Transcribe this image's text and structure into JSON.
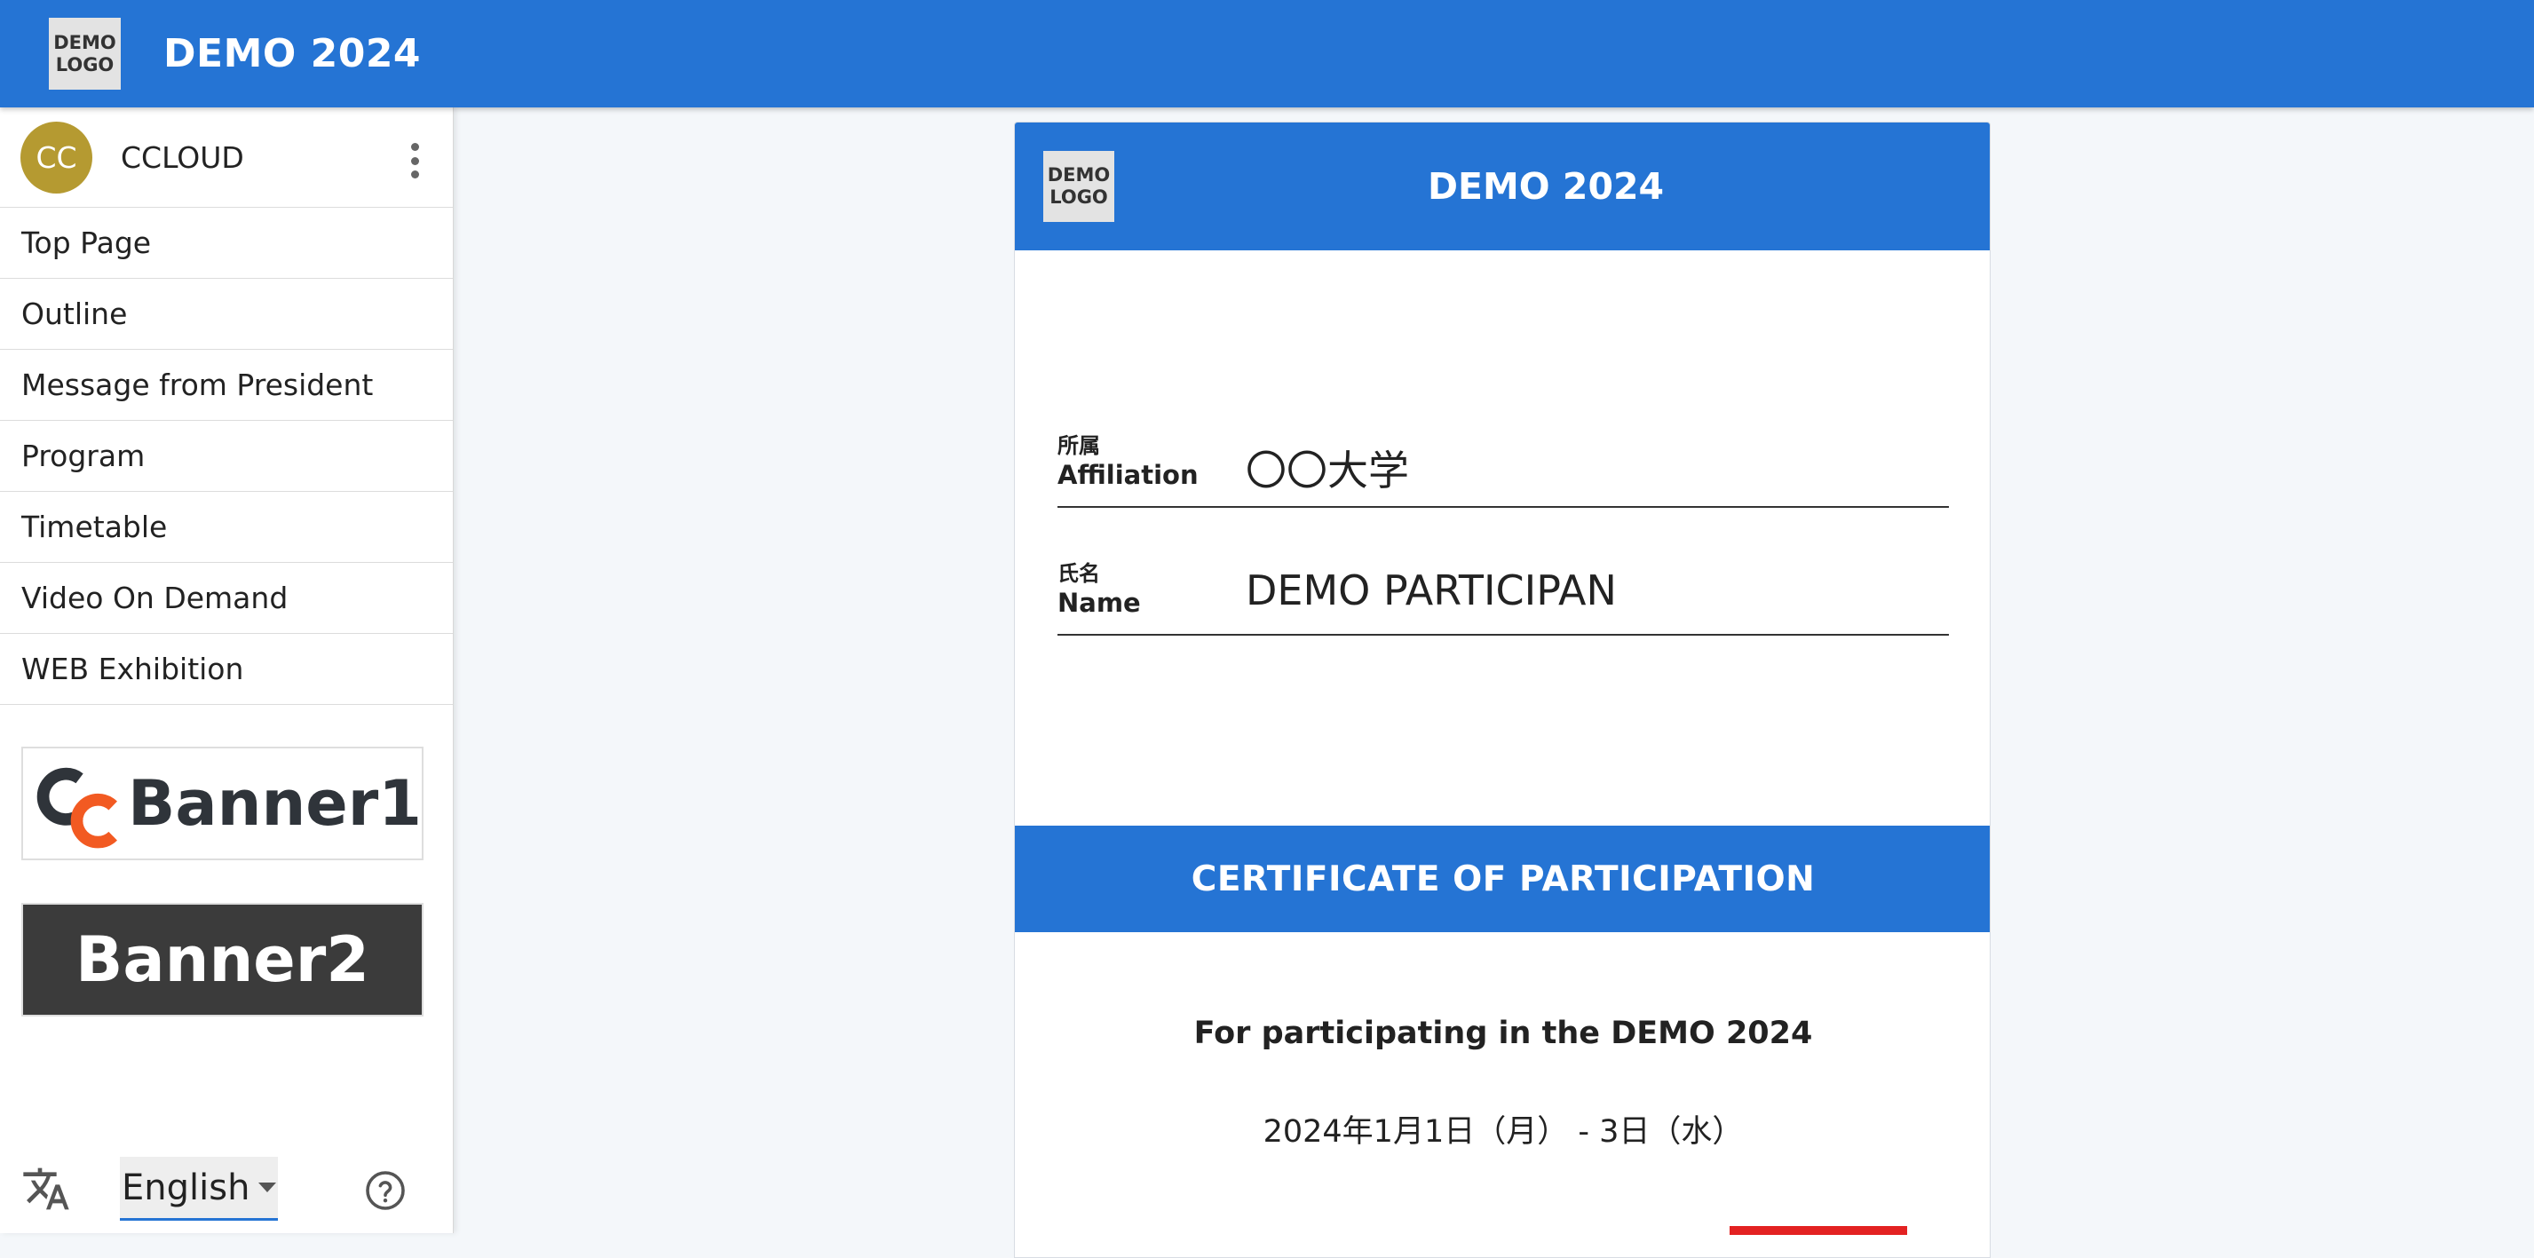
{
  "appbar": {
    "logo_line1": "DEMO",
    "logo_line2": "LOGO",
    "title": "DEMO 2024"
  },
  "sidebar": {
    "user": {
      "initials": "CC",
      "name": "CCLOUD",
      "avatar_color": "#b59a31"
    },
    "items": [
      {
        "label": "Top Page"
      },
      {
        "label": "Outline"
      },
      {
        "label": "Message from President"
      },
      {
        "label": "Program"
      },
      {
        "label": "Timetable"
      },
      {
        "label": "Video On Demand"
      },
      {
        "label": "WEB Exhibition"
      }
    ],
    "banners": {
      "banner1": "Banner1",
      "banner2": "Banner2"
    },
    "language": {
      "selected": "English"
    }
  },
  "certificate": {
    "logo_line1": "DEMO",
    "logo_line2": "LOGO",
    "title": "DEMO 2024",
    "affiliation": {
      "label_jp": "所属",
      "label_en": "Affiliation",
      "value": "〇〇大学"
    },
    "name": {
      "label_jp": "氏名",
      "label_en": "Name",
      "value": "DEMO PARTICIPAN"
    },
    "heading": "CERTIFICATE OF PARTICIPATION",
    "body": "For participating in the DEMO 2024",
    "date": "2024年1月1日（月） - 3日（水）"
  },
  "colors": {
    "primary": "#2574d4",
    "accent_orange": "#f25a22",
    "banner2_bg": "#3b3b3b",
    "mark_red": "#e32222"
  }
}
